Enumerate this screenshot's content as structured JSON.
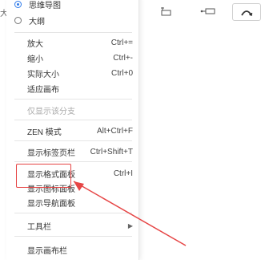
{
  "left_fragment": "大",
  "view_mode": {
    "options": [
      {
        "label": "思维导图",
        "selected": true
      },
      {
        "label": "大纲",
        "selected": false
      }
    ]
  },
  "menu": {
    "zoom_in": {
      "label": "放大",
      "shortcut": "Ctrl+="
    },
    "zoom_out": {
      "label": "缩小",
      "shortcut": "Ctrl+-"
    },
    "actual_size": {
      "label": "实际大小",
      "shortcut": "Ctrl+0"
    },
    "fit_canvas": {
      "label": "适应画布"
    },
    "branch_only": {
      "label": "仅显示该分支"
    },
    "zen_mode": {
      "label": "ZEN 模式",
      "shortcut": "Alt+Ctrl+F"
    },
    "show_tabs_bar": {
      "label": "显示标签页栏",
      "shortcut": "Ctrl+Shift+T"
    },
    "show_format_panel": {
      "label": "显示格式面板",
      "shortcut": "Ctrl+I"
    },
    "show_icon_panel": {
      "label": "显示图标面板"
    },
    "show_nav_panel": {
      "label": "显示导航面板"
    },
    "toolbar": {
      "label": "工具栏"
    },
    "show_canvas_bar": {
      "label": "显示画布栏"
    }
  },
  "colors": {
    "accent": "#2f7bea",
    "annotation": "#e64545"
  },
  "toolbar_icons": [
    "insert-subtopic-icon",
    "insert-topic-icon",
    "relationship-icon"
  ]
}
